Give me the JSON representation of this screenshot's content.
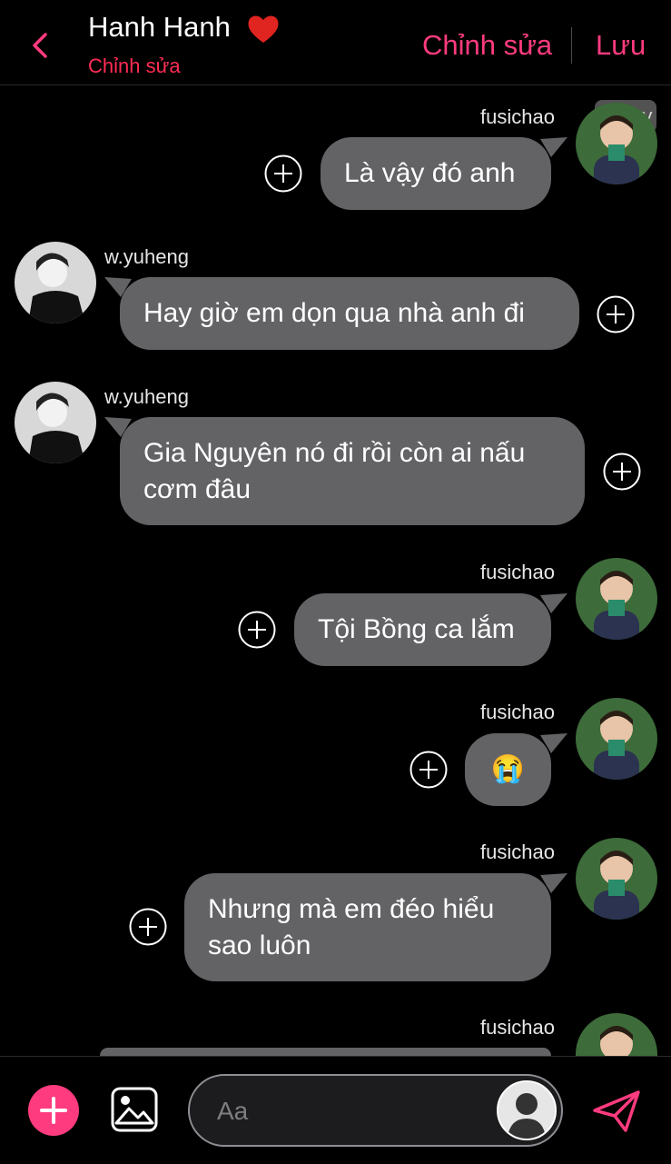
{
  "header": {
    "title": "Hanh Hanh",
    "subtitle": "Chỉnh sửa",
    "edit_label": "Chỉnh sửa",
    "save_label": "Lưu"
  },
  "watermark": "22 joy",
  "messages": [
    {
      "sender": "fusichao",
      "text": "Là vậy đó anh",
      "side": "right"
    },
    {
      "sender": "w.yuheng",
      "text": "Hay giờ em dọn qua nhà anh đi",
      "side": "left"
    },
    {
      "sender": "w.yuheng",
      "text": "Gia Nguyên nó đi rồi còn ai nấu cơm đâu",
      "side": "left"
    },
    {
      "sender": "fusichao",
      "text": "Tội Bồng ca lắm",
      "side": "right"
    },
    {
      "sender": "fusichao",
      "text": "😭",
      "side": "right"
    },
    {
      "sender": "fusichao",
      "text": "Nhưng mà em đéo hiểu sao luôn",
      "side": "right"
    },
    {
      "sender": "fusichao",
      "text": "",
      "side": "right"
    }
  ],
  "composer": {
    "placeholder": "Aa"
  },
  "colors": {
    "accent": "#ff3b7f",
    "bubble": "#636366",
    "background": "#000000"
  }
}
